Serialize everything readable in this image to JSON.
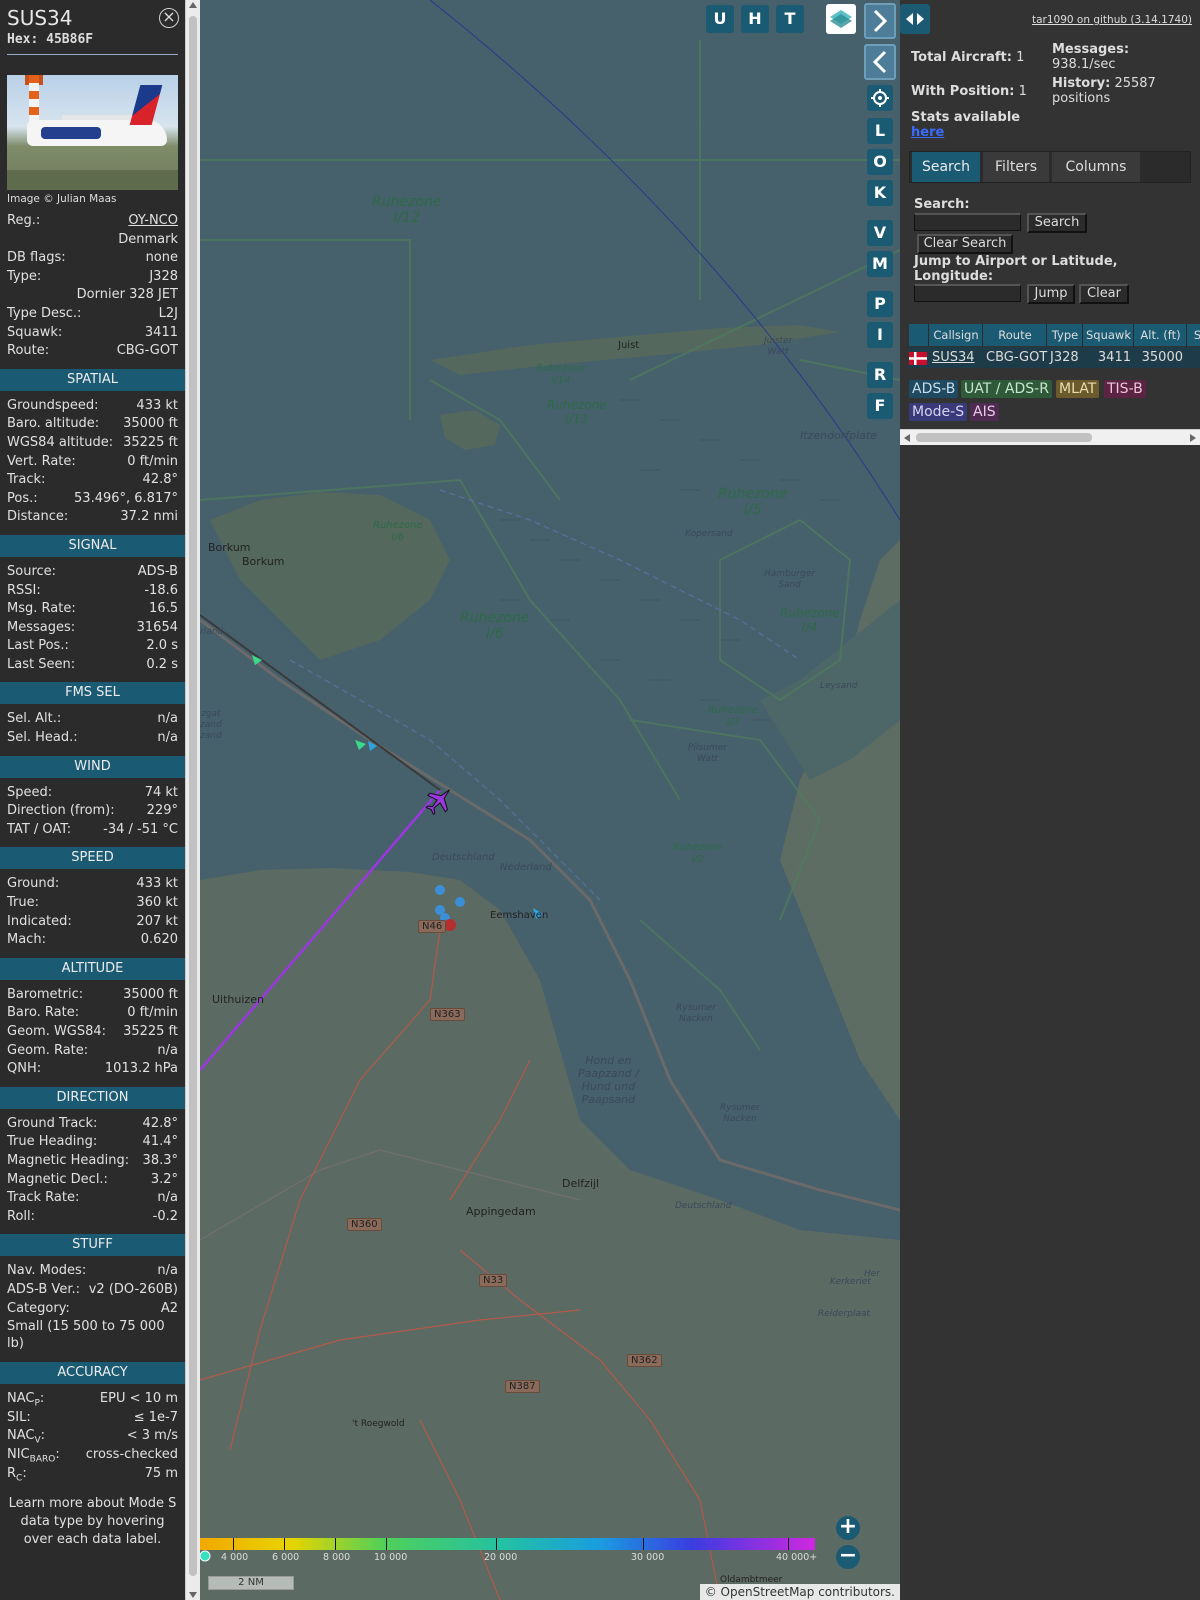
{
  "info": {
    "callsign": "SUS34",
    "hex_label": "Hex:",
    "hex": "45B86F",
    "photo_credit": "Image © Julian Maas",
    "general": [
      {
        "k": "Reg.:",
        "v": "OY-NCO",
        "link": true
      },
      {
        "k": "",
        "v": "Denmark"
      },
      {
        "k": "DB flags:",
        "v": "none"
      },
      {
        "k": "Type:",
        "v": "J328"
      },
      {
        "k": "",
        "v": "Dornier 328 JET"
      },
      {
        "k": "Type Desc.:",
        "v": "L2J"
      },
      {
        "k": "Squawk:",
        "v": "3411"
      },
      {
        "k": "Route:",
        "v": "CBG-GOT"
      }
    ],
    "sections": [
      {
        "title": "SPATIAL",
        "rows": [
          {
            "k": "Groundspeed:",
            "v": "433 kt"
          },
          {
            "k": "Baro. altitude:",
            "v": "35000 ft"
          },
          {
            "k": "WGS84 altitude:",
            "v": "35225 ft"
          },
          {
            "k": "Vert. Rate:",
            "v": "0 ft/min"
          },
          {
            "k": "Track:",
            "v": "42.8°"
          },
          {
            "k": "Pos.:",
            "v": "53.496°, 6.817°"
          },
          {
            "k": "Distance:",
            "v": "37.2 nmi"
          }
        ]
      },
      {
        "title": "SIGNAL",
        "rows": [
          {
            "k": "Source:",
            "v": "ADS-B"
          },
          {
            "k": "RSSI:",
            "v": "-18.6"
          },
          {
            "k": "Msg. Rate:",
            "v": "16.5"
          },
          {
            "k": "Messages:",
            "v": "31654"
          },
          {
            "k": "Last Pos.:",
            "v": "2.0 s"
          },
          {
            "k": "Last Seen:",
            "v": "0.2 s"
          }
        ]
      },
      {
        "title": "FMS SEL",
        "rows": [
          {
            "k": "Sel. Alt.:",
            "v": "n/a"
          },
          {
            "k": "Sel. Head.:",
            "v": "n/a"
          }
        ]
      },
      {
        "title": "WIND",
        "rows": [
          {
            "k": "Speed:",
            "v": "74 kt"
          },
          {
            "k": "Direction (from):",
            "v": "229°"
          },
          {
            "k": "TAT / OAT:",
            "v": "-34 / -51 °C"
          }
        ]
      },
      {
        "title": "SPEED",
        "rows": [
          {
            "k": "Ground:",
            "v": "433 kt"
          },
          {
            "k": "True:",
            "v": "360 kt"
          },
          {
            "k": "Indicated:",
            "v": "207 kt"
          },
          {
            "k": "Mach:",
            "v": "0.620"
          }
        ]
      },
      {
        "title": "ALTITUDE",
        "rows": [
          {
            "k": "Barometric:",
            "v": "35000 ft"
          },
          {
            "k": "Baro. Rate:",
            "v": "0 ft/min"
          },
          {
            "k": "Geom. WGS84:",
            "v": "35225 ft"
          },
          {
            "k": "Geom. Rate:",
            "v": "n/a"
          },
          {
            "k": "QNH:",
            "v": "1013.2 hPa"
          }
        ]
      },
      {
        "title": "DIRECTION",
        "rows": [
          {
            "k": "Ground Track:",
            "v": "42.8°"
          },
          {
            "k": "True Heading:",
            "v": "41.4°"
          },
          {
            "k": "Magnetic Heading:",
            "v": "38.3°"
          },
          {
            "k": "Magnetic Decl.:",
            "v": "3.2°"
          },
          {
            "k": "Track Rate:",
            "v": "n/a"
          },
          {
            "k": "Roll:",
            "v": "-0.2"
          }
        ]
      },
      {
        "title": "STUFF",
        "rows": [
          {
            "k": "Nav. Modes:",
            "v": "n/a"
          },
          {
            "k": "ADS-B Ver.:",
            "v": "v2 (DO-260B)"
          },
          {
            "k": "Category:",
            "v": "A2"
          },
          {
            "k": "Small (15 500 to 75 000 lb)",
            "v": "",
            "wrap": true
          }
        ]
      },
      {
        "title": "ACCURACY",
        "rows": [
          {
            "k": "NAC",
            "sub": "P",
            "k2": ":",
            "v": "EPU < 10 m"
          },
          {
            "k": "SIL:",
            "v": "≤ 1e-7"
          },
          {
            "k": "NAC",
            "sub": "V",
            "k2": ":",
            "v": "< 3 m/s"
          },
          {
            "k": "NIC",
            "sub": "BARO",
            "k2": ":",
            "v": "cross-checked"
          },
          {
            "k": "R",
            "sub": "C",
            "k2": ":",
            "v": "75 m"
          }
        ]
      }
    ],
    "learn_more": "Learn more about Mode S data type by hovering over each data label."
  },
  "map": {
    "buttons_top": [
      "U",
      "H",
      "T"
    ],
    "buttons_side": [
      "L",
      "O",
      "K",
      "V",
      "M",
      "P",
      "I",
      "R",
      "F"
    ],
    "labels": {
      "ruhezone_i12": [
        "Ruhezone",
        "I/12"
      ],
      "ruhezone_i14": [
        "Ruhezone",
        "I/14"
      ],
      "ruhezone_i13": [
        "Ruhezone",
        "I/13"
      ],
      "ruhezone_i5": [
        "Ruhezone",
        "I/5"
      ],
      "ruhezone_i6": [
        "Ruhezone",
        "I/6"
      ],
      "ruhezone_i6b": [
        "Ruhezone",
        "I/6"
      ],
      "ruhezone_i4": [
        "Ruhezone",
        "I/4"
      ],
      "ruhezone_i3": [
        "Ruhezone",
        "I/3"
      ],
      "ruhezone_i2": [
        "Ruhezone",
        "I/2"
      ],
      "juist": "Juist",
      "juister_watt": [
        "Juister",
        "Watt"
      ],
      "itzendorfplate": "Itzendorfplate",
      "borkum": "Borkum",
      "borkum2": "Borkum",
      "kopersand": "Kopersand",
      "hamburger_sand": [
        "Hamburger",
        "Sand"
      ],
      "leysand": "Leysand",
      "pilsumer_watt": [
        "Pilsumer",
        "Watt"
      ],
      "deutschland": "Deutschland",
      "nederland": "Nederland",
      "eemshaven": "Eemshaven",
      "uithuizen": "Uithuizen",
      "rysumer_nacken": [
        "Rysumer",
        "Nacken"
      ],
      "rysumer_nacken2": [
        "Rysumer",
        "Nacken"
      ],
      "hond_en_paapzand": [
        "Hond en",
        "Paapzand /",
        "Hund und",
        "Paapsand"
      ],
      "delfzijl": "Delfzijl",
      "appingedam": "Appingedam",
      "deutschland2": "Deutschland",
      "kerkeriet": "Kerkeriet",
      "reiderplaat": "Reiderplaat",
      "roegwold": "'t Roegwold",
      "oldambtmeer": "Oldambtmeer",
      "nederland_left": "rland",
      "zand_left": [
        "zgat",
        "zand",
        "zand"
      ],
      "her": "Her"
    },
    "roads": [
      "N46",
      "N363",
      "N360",
      "N33",
      "N362",
      "N387"
    ],
    "altitude_ticks": [
      "4 000",
      "6 000",
      "8 000",
      "10 000",
      "20 000",
      "30 000",
      "40 000+"
    ],
    "scale": "2 NM",
    "attribution": "© OpenStreetMap contributors."
  },
  "sidebar": {
    "github": "tar1090 on github (3.14.1740)",
    "total_aircraft_label": "Total Aircraft:",
    "total_aircraft": "1",
    "with_position_label": "With Position:",
    "with_position": "1",
    "stats_label": "Stats available",
    "stats_link": "here",
    "messages_label": "Messages:",
    "messages": "938.1/sec",
    "history_label": "History:",
    "history": "25587 positions",
    "tabs": [
      "Search",
      "Filters",
      "Columns"
    ],
    "search_label": "Search:",
    "search_button": "Search",
    "clear_search": "Clear Search",
    "jump_label": "Jump to Airport or Latitude, Longitude:",
    "jump_button": "Jump",
    "clear_button": "Clear",
    "table_headers": [
      "Callsign",
      "Route",
      "Type",
      "Squawk",
      "Alt. (ft)",
      "S"
    ],
    "row": {
      "callsign": "SUS34",
      "route": "CBG-GOT",
      "type": "J328",
      "squawk": "3411",
      "alt": "35000"
    },
    "source_chips": [
      {
        "label": "ADS-B",
        "bg": "#1f4a62",
        "fg": "#c9dde8"
      },
      {
        "label": "UAT / ADS-R",
        "bg": "#2f5a3a",
        "fg": "#c9e4cf"
      },
      {
        "label": "MLAT",
        "bg": "#6a5a2c",
        "fg": "#ecdcae"
      },
      {
        "label": "TIS-B",
        "bg": "#5a2442",
        "fg": "#f0c4da"
      },
      {
        "label": "Mode-S",
        "bg": "#3a3a7a",
        "fg": "#d4d4f2"
      },
      {
        "label": "AIS",
        "bg": "#4e2c52",
        "fg": "#ecc8ec"
      }
    ]
  }
}
